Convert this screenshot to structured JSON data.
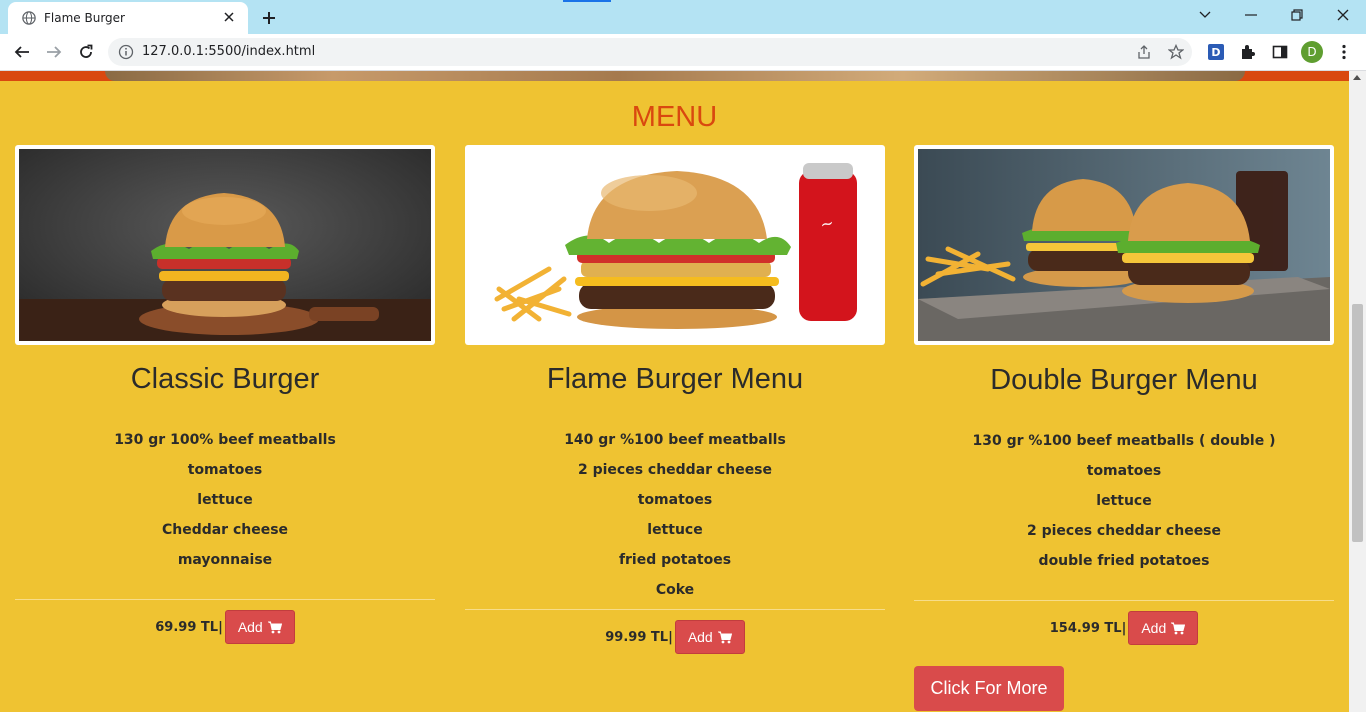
{
  "browser": {
    "tab_title": "Flame Burger",
    "url": "127.0.0.1:5500/index.html",
    "profile_initial": "D",
    "extension_initial": "D"
  },
  "page": {
    "menu_title": "MENU",
    "more_button": "Click For More",
    "colors": {
      "background": "#efc332",
      "accent": "#d9480f",
      "button": "#d94b4b"
    }
  },
  "cards": [
    {
      "title": "Classic Burger",
      "ingredients": [
        "130 gr 100% beef meatballs",
        "tomatoes",
        "lettuce",
        "Cheddar cheese",
        "mayonnaise"
      ],
      "price": "69.99 TL|",
      "add_label": "Add",
      "icon": "cart-icon"
    },
    {
      "title": "Flame Burger Menu",
      "ingredients": [
        "140 gr %100 beef meatballs",
        "2 pieces cheddar cheese",
        "tomatoes",
        "lettuce",
        "fried potatoes",
        "Coke"
      ],
      "price": "99.99 TL|",
      "add_label": "Add",
      "icon": "cart-icon"
    },
    {
      "title": "Double Burger Menu",
      "ingredients": [
        "130 gr %100 beef meatballs ( double )",
        "tomatoes",
        "lettuce",
        "2 pieces cheddar cheese",
        "double fried potatoes"
      ],
      "price": "154.99 TL|",
      "add_label": "Add",
      "icon": "cart-icon"
    }
  ]
}
